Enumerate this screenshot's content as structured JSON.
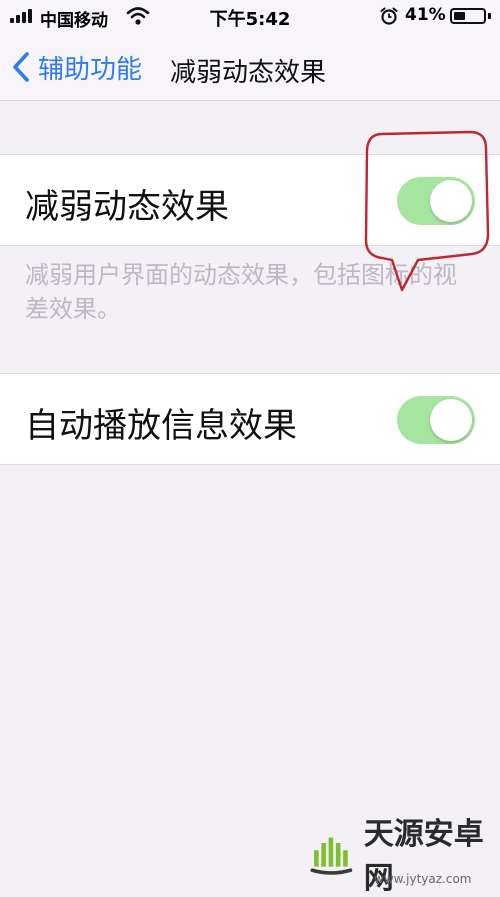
{
  "status_bar": {
    "carrier": "中国移动",
    "time": "下午5:42",
    "battery_percent": "41%",
    "battery_level": 0.41,
    "icons": [
      "signal-icon",
      "wifi-icon",
      "alarm-icon",
      "battery-icon"
    ]
  },
  "nav": {
    "back_label": "辅助功能",
    "title": "减弱动态效果"
  },
  "settings": [
    {
      "label": "减弱动态效果",
      "on": true
    },
    {
      "label": "自动播放信息效果",
      "on": true
    }
  ],
  "footer": "减弱用户界面的动态效果，包括图标的视差效果。",
  "watermark": {
    "text": "天源安卓网",
    "url": "www.jytyaz.com"
  },
  "colors": {
    "accent": "#2f7bf0",
    "toggle_on": "#a5e59f",
    "annotation": "#c0272d",
    "background": "#f3f0f6"
  }
}
